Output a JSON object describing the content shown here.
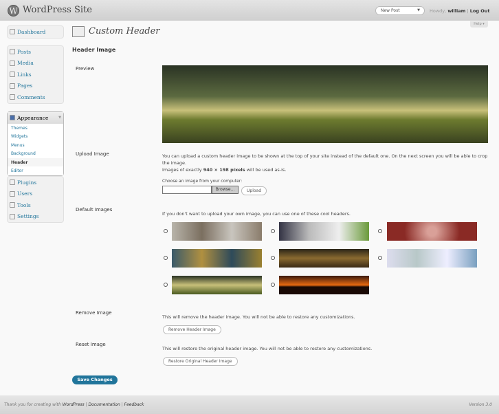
{
  "topbar": {
    "site_name": "WordPress Site",
    "logo": "W",
    "new_post": "New Post",
    "howdy": "Howdy,",
    "user": "william",
    "logout": "Log Out"
  },
  "help": "Help ▾",
  "sidebar": {
    "dashboard": "Dashboard",
    "items": [
      "Posts",
      "Media",
      "Links",
      "Pages",
      "Comments"
    ],
    "appearance": "Appearance",
    "appearance_sub": [
      "Themes",
      "Widgets",
      "Menus",
      "Background",
      "Header",
      "Editor"
    ],
    "items2": [
      "Plugins",
      "Users",
      "Tools",
      "Settings"
    ]
  },
  "page": {
    "title": "Custom Header",
    "section": "Header Image"
  },
  "labels": {
    "preview": "Preview",
    "upload": "Upload Image",
    "defaults": "Default Images",
    "remove": "Remove Image",
    "reset": "Reset Image"
  },
  "upload": {
    "line1": "You can upload a custom header image to be shown at the top of your site instead of the default one. On the next screen you will be able to crop the image.",
    "line2_pre": "Images of exactly ",
    "line2_bold": "940 × 198 pixels",
    "line2_post": " will be used as-is.",
    "choose": "Choose an image from your computer:",
    "browse": "Browse...",
    "upload_btn": "Upload"
  },
  "defaults": {
    "intro": "If you don't want to upload your own image, you can use one of these cool headers."
  },
  "remove": {
    "text": "This will remove the header image. You will not be able to restore any customizations.",
    "button": "Remove Header Image"
  },
  "reset": {
    "text": "This will restore the original header image. You will not be able to restore any customizations.",
    "button": "Restore Original Header Image"
  },
  "save": "Save Changes",
  "footer": {
    "thanks": "Thank you for creating with",
    "wp": "WordPress",
    "doc": "Documentation",
    "feedback": "Feedback",
    "version": "Version 3.0"
  }
}
